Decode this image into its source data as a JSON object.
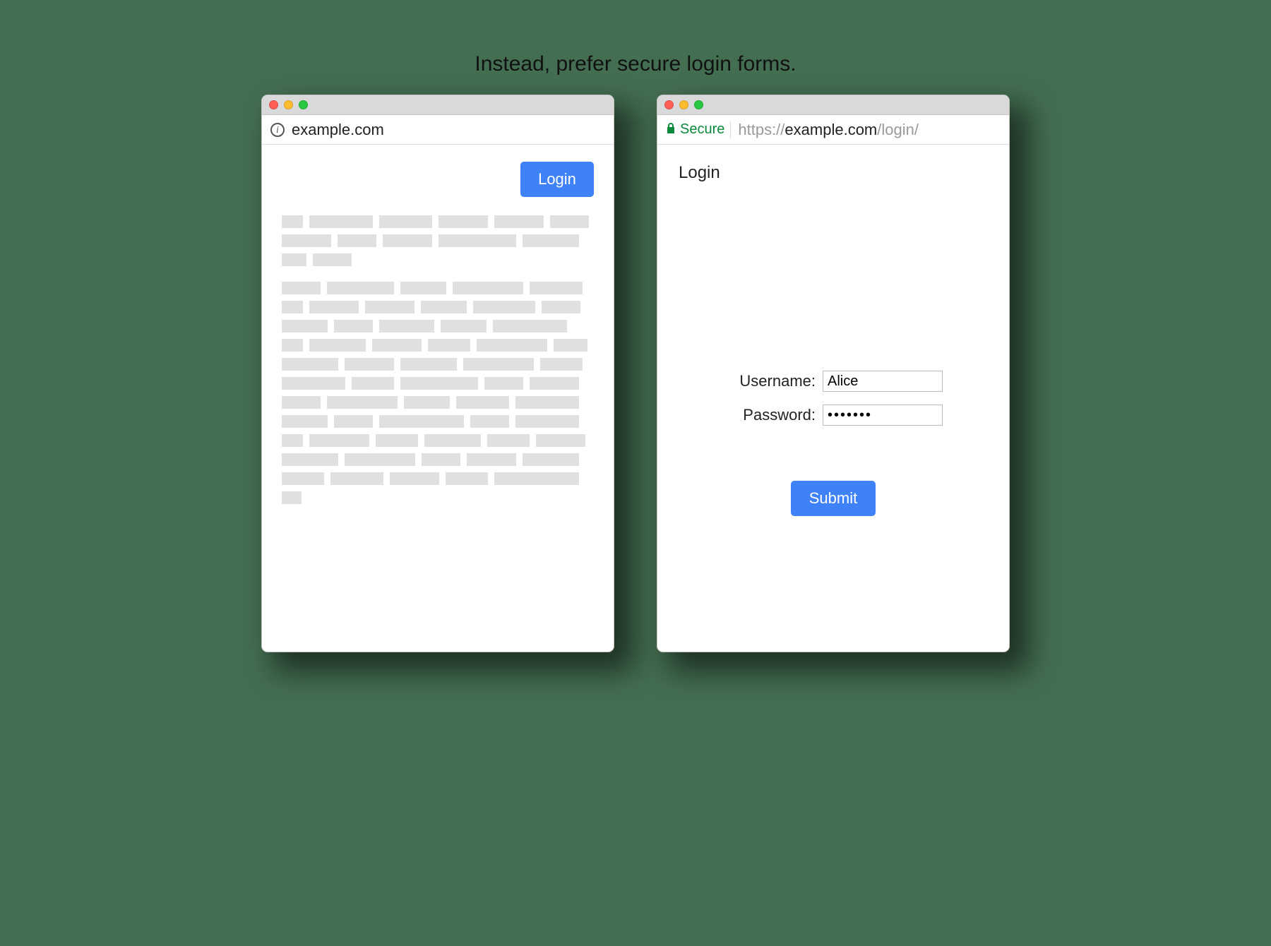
{
  "caption": "Instead, prefer secure login forms.",
  "left_window": {
    "address": {
      "text": "example.com"
    },
    "login_button": "Login"
  },
  "right_window": {
    "address": {
      "secure_label": "Secure",
      "protocol": "https://",
      "host": "example.com",
      "path": "/login/"
    },
    "page_title": "Login",
    "form": {
      "username_label": "Username:",
      "username_value": "Alice",
      "password_label": "Password:",
      "password_value": "•••••••",
      "submit_label": "Submit"
    }
  },
  "colors": {
    "background": "#446e51",
    "accent_button": "#3f82f7",
    "secure_green": "#0b8a3e",
    "skeleton_grey": "#e0e0e0"
  }
}
